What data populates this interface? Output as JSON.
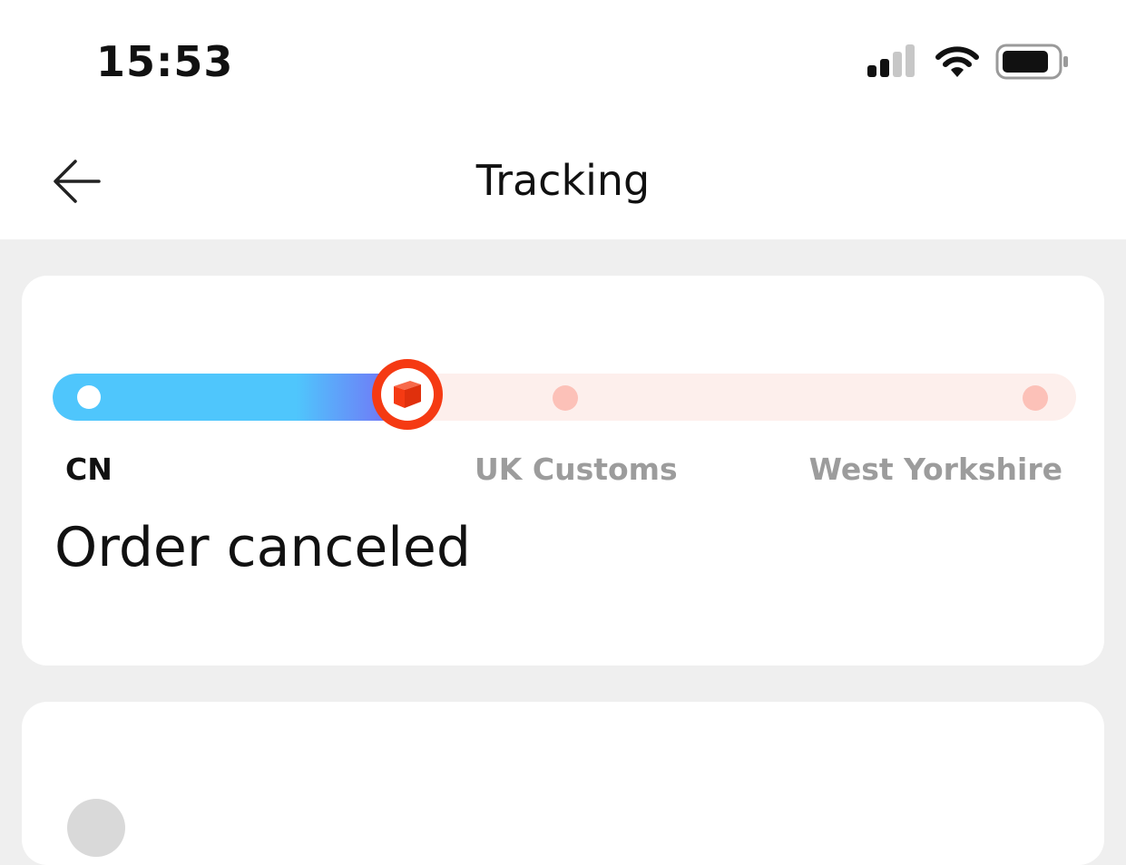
{
  "status_bar": {
    "time": "15:53",
    "icons": [
      "cellular-signal-icon",
      "wifi-icon",
      "battery-icon"
    ]
  },
  "nav": {
    "title": "Tracking",
    "back_icon": "arrow-left-icon"
  },
  "tracking": {
    "progress": 0.35,
    "current_marker_icon": "package-icon",
    "stops": [
      {
        "label": "CN",
        "state": "passed"
      },
      {
        "label": "UK Customs",
        "state": "pending"
      },
      {
        "label": "West Yorkshire",
        "state": "pending"
      }
    ],
    "status": "Order canceled"
  },
  "colors": {
    "progress_start": "#4fc6fc",
    "progress_end": "#7a63f5",
    "marker": "#f53a13",
    "pending_dot": "#fcc1b8",
    "pending_track": "#fdefec",
    "pending_label": "#9c9c9c"
  }
}
